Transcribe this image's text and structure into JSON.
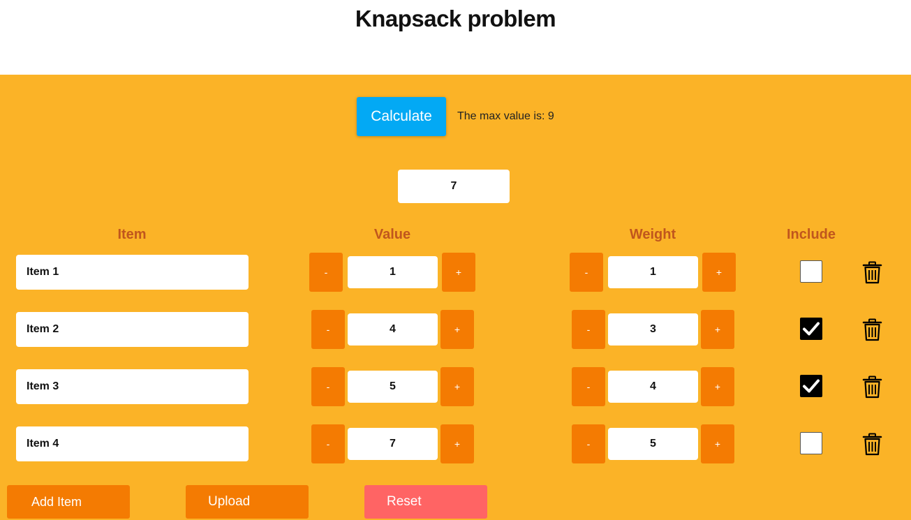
{
  "title": "Knapsack problem",
  "colors": {
    "panel": "#fbb327",
    "accent_orange": "#f47b02",
    "calculate_blue": "#03a9f4",
    "reset_red": "#ff6464",
    "header_text": "#c0561d"
  },
  "controls": {
    "calculate_label": "Calculate",
    "result_text": "The max value is: 9",
    "capacity_value": "7"
  },
  "headers": {
    "item": "Item",
    "value": "Value",
    "weight": "Weight",
    "include": "Include"
  },
  "rows": [
    {
      "name": "Item 1",
      "value": "1",
      "weight": "1",
      "included": false
    },
    {
      "name": "Item 2",
      "value": "4",
      "weight": "3",
      "included": true
    },
    {
      "name": "Item 3",
      "value": "5",
      "weight": "4",
      "included": true
    },
    {
      "name": "Item 4",
      "value": "7",
      "weight": "5",
      "included": false
    }
  ],
  "stepper": {
    "minus": "-",
    "plus": "+"
  },
  "icons": {
    "checkmark": "check-icon",
    "delete": "trash-icon"
  },
  "buttons": {
    "add_item": "Add Item",
    "upload": "Upload",
    "reset": "Reset"
  }
}
